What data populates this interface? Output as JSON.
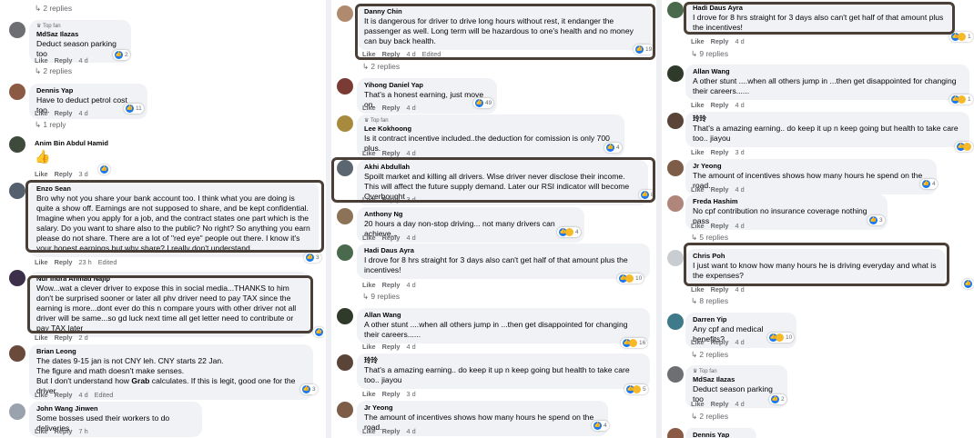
{
  "labels": {
    "like": "Like",
    "reply": "Reply",
    "edited": "Edited",
    "top_fan": "Top fan"
  },
  "colors": {
    "bubble": "#f0f2f5",
    "highlight": "#4a3f37",
    "like_blue": "#1877f2",
    "meta_gray": "#65676b"
  },
  "left_column": {
    "top_replies": "2 replies",
    "c1": {
      "author": "MdSaz Ilazas",
      "text": "Deduct season parking too",
      "time": "4 d",
      "reactions": "2",
      "replies": "2 replies"
    },
    "c2": {
      "author": "Dennis Yap",
      "text": "Have to deduct petrol cost too.",
      "time": "4 d",
      "reactions": "11",
      "replies": "1 reply"
    },
    "c3": {
      "author": "Anim Bin Abdul Hamid",
      "text": "👍",
      "time": "3 d"
    },
    "c4": {
      "author": "Enzo Sean",
      "text": "Bro why not you share your bank account too. I think what you are doing is quite a show off. Earnings are not supposed to share, and be kept confidential. Imagine when you apply for a job, and the contract states one part which is the salary. Do you want to share also to the public? No right? So anything you earn please do not share. There are a lot of \"red eye\" people out there. I know it's your honest earnings but why share? I really don't understand.",
      "time": "23 h",
      "reactions": "3"
    },
    "c5": {
      "author": "Nur Indra Ahmad Najip",
      "text": "Wow...wat a clever driver to expose this in social media...THANKS to him don't be surprised sooner or later all phv driver need to pay TAX since the earning is more...dont ever do this n compare yours with other driver not all driver will be same...so gd luck next time all get letter need to contribute or pay TAX later",
      "time": "2 d"
    },
    "c6": {
      "author": "Brian Leong",
      "text1": "The dates 9-15 jan is not CNY leh. CNY starts 22 Jan.",
      "text2": "The figure and math doesn't make senses.",
      "text3a": "But I don't understand how ",
      "text3b": "Grab",
      "text3c": " calculates. If this is legit, good one for the driver.",
      "time": "4 d",
      "reactions": "3"
    },
    "c7": {
      "author": "John Wang Jinwen",
      "text": "Some bosses used their workers to do deliveries",
      "time": "7 h"
    }
  },
  "middle_column": {
    "c1": {
      "author": "Danny Chin",
      "text": "It is dangerous for driver to drive long hours without rest, it endanger the passenger as well. Long term will be hazardous to one's health and no money can buy back health.",
      "time": "4 d",
      "reactions": "19",
      "replies": "2 replies"
    },
    "c2": {
      "author": "Yihong Daniel Yap",
      "text": "That's a honest earning, just move on.",
      "time": "4 d",
      "reactions": "49"
    },
    "c3": {
      "author": "Lee Kokhoong",
      "text": "Is it contract incentive included..the deduction for comission is only 700 plus.",
      "time": "4 d",
      "reactions": "4"
    },
    "c4": {
      "author": "Akhi Abdullah",
      "text": "Spoilt market and killing all drivers. Wise driver never disclose their income. This will affect the future supply demand. Later our RSI indicator will become Overbought",
      "time": "3 d",
      "reactions": "8"
    },
    "c5": {
      "author": "Anthony Ng",
      "text": "20 hours a day non-stop driving... not many drivers can achieve...",
      "time": "4 d",
      "reactions": "4"
    },
    "c6": {
      "author": "Hadi Daus Ayra",
      "text": "I drove for 8 hrs straight for 3 days also can't get half of that amount plus the incentives!",
      "time": "4 d",
      "reactions": "10",
      "replies": "9 replies"
    },
    "c7": {
      "author": "Allan Wang",
      "text": "A other stunt ....when all others jump in ...then get disappointed for changing their careers......",
      "time": "4 d",
      "reactions": "16"
    },
    "c8": {
      "author": "玲玲",
      "text": "That's a amazing earning.. do keep it up n keep going but health to take care too.. jiayou",
      "time": "3 d",
      "reactions": "5"
    },
    "c9": {
      "author": "Jr Yeong",
      "text": "The amount of incentives shows how many hours he spend on the road.",
      "time": "4 d",
      "reactions": "4"
    }
  },
  "right_column": {
    "c1": {
      "author": "Hadi Daus Ayra",
      "text": "I drove for 8 hrs straight for 3 days also can't get half of that amount plus the incentives!",
      "time": "4 d",
      "reactions": "1",
      "replies": "9 replies"
    },
    "c2": {
      "author": "Allan Wang",
      "text": "A other stunt ....when all others jump in ...then get disappointed for changing their careers......",
      "time": "4 d",
      "reactions": "1"
    },
    "c3": {
      "author": "玲玲",
      "text": "That's a amazing earning.. do keep it up n keep going but health to take care too.. jiayou",
      "time": "3 d"
    },
    "c4": {
      "author": "Jr Yeong",
      "text": "The amount of incentives shows how many hours he spend on the road.",
      "time": "4 d",
      "reactions": "4"
    },
    "c5": {
      "author": "Freda Hashim",
      "text": "No cpf contribution no insurance coverage nothing pass",
      "time": "4 d",
      "reactions": "3",
      "replies": "5 replies"
    },
    "c6": {
      "author": "Chris Poh",
      "text": "I just want to know how many hours he is driving everyday and what is the expenses?",
      "time": "4 d",
      "replies": "8 replies"
    },
    "c7": {
      "author": "Darren Yip",
      "text": "Any cpf and medical benefits?",
      "time": "4 d",
      "reactions": "10",
      "replies": "2 replies"
    },
    "c8": {
      "author": "MdSaz Ilazas",
      "text": "Deduct season parking too",
      "time": "4 d",
      "reactions": "2",
      "replies": "2 replies"
    },
    "c9": {
      "author": "Dennis Yap"
    }
  }
}
